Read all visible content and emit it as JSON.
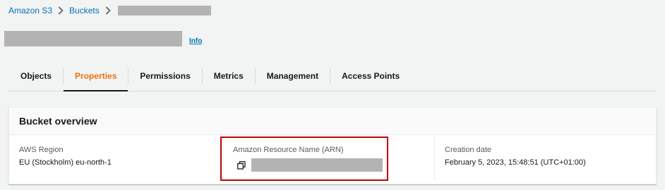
{
  "breadcrumb": {
    "items": [
      {
        "label": "Amazon S3"
      },
      {
        "label": "Buckets"
      }
    ]
  },
  "header": {
    "info_label": "Info"
  },
  "tabs": [
    {
      "label": "Objects",
      "active": false
    },
    {
      "label": "Properties",
      "active": true
    },
    {
      "label": "Permissions",
      "active": false
    },
    {
      "label": "Metrics",
      "active": false
    },
    {
      "label": "Management",
      "active": false
    },
    {
      "label": "Access Points",
      "active": false
    }
  ],
  "bucket_overview": {
    "title": "Bucket overview",
    "region_label": "AWS Region",
    "region_value": "EU (Stockholm) eu-north-1",
    "arn_label": "Amazon Resource Name (ARN)",
    "creation_label": "Creation date",
    "creation_value": "February 5, 2023, 15:48:51 (UTC+01:00)"
  },
  "icons": {
    "breadcrumb_separator": "chevron-right-icon",
    "copy": "copy-icon"
  },
  "colors": {
    "link": "#0073bb",
    "active_tab": "#ec7211",
    "highlight_border": "#c00000"
  }
}
